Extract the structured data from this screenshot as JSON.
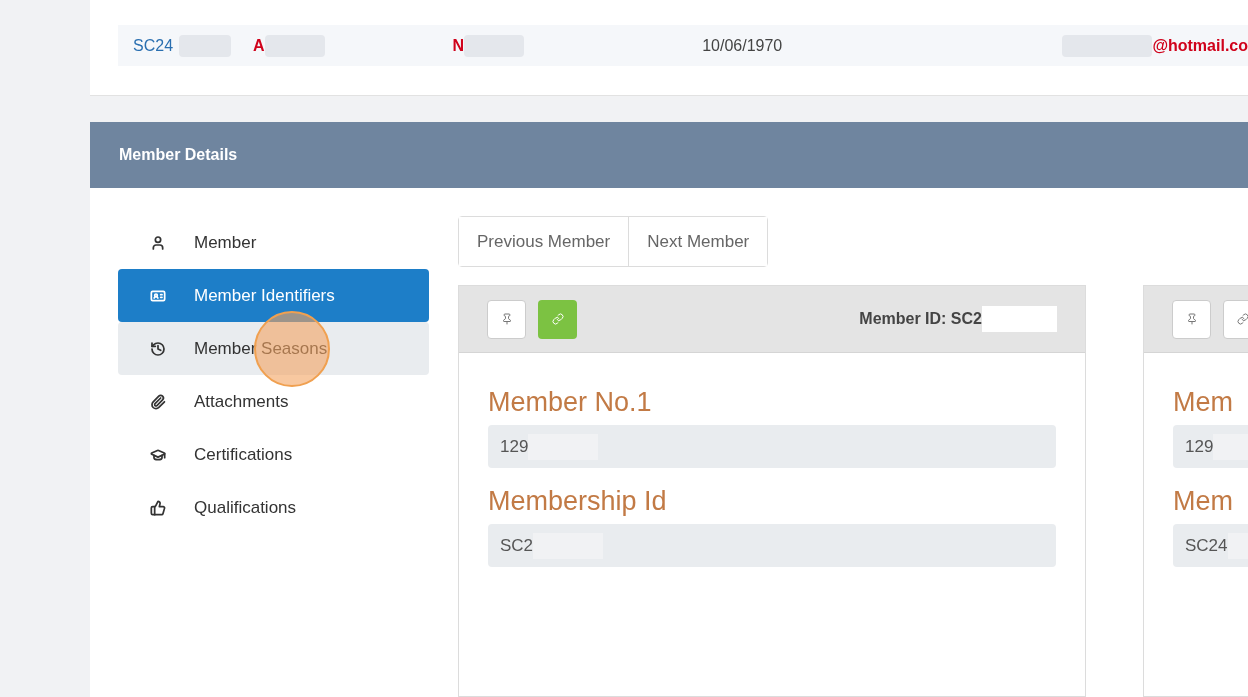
{
  "top_row": {
    "cells": [
      {
        "kind": "link",
        "text": "SC24"
      },
      {
        "kind": "flag",
        "text": "A"
      },
      {
        "kind": "flag",
        "text": "N"
      },
      {
        "kind": "plain",
        "text": "10/06/1970"
      },
      {
        "kind": "email",
        "text": "@hotmail.co"
      }
    ]
  },
  "panel": {
    "title": "Member Details"
  },
  "sidebar": {
    "items": [
      {
        "label": "Member",
        "selected": false,
        "hovered": false
      },
      {
        "label": "Member Identifiers",
        "selected": true,
        "hovered": false
      },
      {
        "label": "Member Seasons",
        "selected": false,
        "hovered": true
      },
      {
        "label": "Attachments",
        "selected": false,
        "hovered": false
      },
      {
        "label": "Certifications",
        "selected": false,
        "hovered": false
      },
      {
        "label": "Qualifications",
        "selected": false,
        "hovered": false
      }
    ]
  },
  "nav_buttons": [
    "Previous Member",
    "Next Member"
  ],
  "cards": [
    {
      "header_text": "Member ID: SC2",
      "link_active": true,
      "fields": [
        {
          "label": "Member No.1",
          "value": "129"
        },
        {
          "label": "Membership Id",
          "value": "SC2"
        }
      ]
    },
    {
      "link_active": false,
      "fields": [
        {
          "label": "Mem",
          "value": "129"
        },
        {
          "label": "Mem",
          "value": "SC24"
        }
      ]
    }
  ]
}
